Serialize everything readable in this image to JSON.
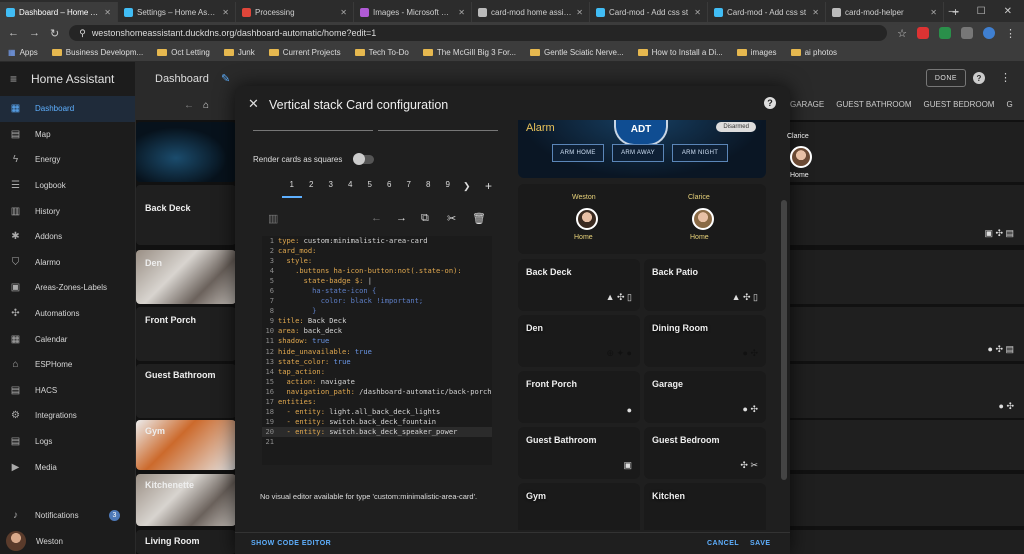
{
  "browser": {
    "tabs": [
      {
        "title": "Dashboard – Home Assistant",
        "color": "#41bdf5",
        "active": true
      },
      {
        "title": "Settings – Home Assistant",
        "color": "#41bdf5",
        "active": false
      },
      {
        "title": "Processing",
        "color": "#e0463a",
        "active": false
      },
      {
        "title": "Images - Microsoft Design",
        "color": "#b15bd6",
        "active": false
      },
      {
        "title": "card-mod home assistant",
        "color": "#bbbbbb",
        "active": false
      },
      {
        "title": "Card-mod - Add css st",
        "color": "#41bdf5",
        "active": false
      },
      {
        "title": "Card-mod - Add css st",
        "color": "#41bdf5",
        "active": false
      },
      {
        "title": "card-mod-helper",
        "color": "#bbbbbb",
        "active": false
      }
    ],
    "address": "westonshomeassistant.duckdns.org/dashboard-automatic/home?edit=1",
    "bookmarks": [
      "Apps",
      "Business Developm...",
      "Oct Letting",
      "Junk",
      "Current Projects",
      "Tech To-Do",
      "The McGill Big 3 For...",
      "Gentle Sciatic Nerve...",
      "How to Install a Di...",
      "images",
      "ai photos"
    ]
  },
  "sidebar": {
    "app_title": "Home Assistant",
    "items": [
      {
        "label": "Dashboard",
        "icon": "dashboard-icon",
        "glyph": "▦"
      },
      {
        "label": "Map",
        "icon": "map-icon",
        "glyph": "▤"
      },
      {
        "label": "Energy",
        "icon": "energy-icon",
        "glyph": "ϟ"
      },
      {
        "label": "Logbook",
        "icon": "logbook-icon",
        "glyph": "☰"
      },
      {
        "label": "History",
        "icon": "history-icon",
        "glyph": "▥"
      },
      {
        "label": "Addons",
        "icon": "addons-icon",
        "glyph": "✱"
      },
      {
        "label": "Alarmo",
        "icon": "shield-icon",
        "glyph": "⛉"
      },
      {
        "label": "Areas-Zones-Labels",
        "icon": "areas-icon",
        "glyph": "▣"
      },
      {
        "label": "Automations",
        "icon": "automations-icon",
        "glyph": "✣"
      },
      {
        "label": "Calendar",
        "icon": "calendar-icon",
        "glyph": "▦"
      },
      {
        "label": "ESPHome",
        "icon": "esphome-icon",
        "glyph": "⌂"
      },
      {
        "label": "HACS",
        "icon": "hacs-icon",
        "glyph": "▤"
      },
      {
        "label": "Integrations",
        "icon": "integrations-icon",
        "glyph": "⚙"
      },
      {
        "label": "Logs",
        "icon": "logs-icon",
        "glyph": "▤"
      },
      {
        "label": "Media",
        "icon": "media-icon",
        "glyph": "▶"
      }
    ],
    "notifications_label": "Notifications",
    "notifications_count": "3",
    "user_name": "Weston"
  },
  "header": {
    "title": "Dashboard",
    "done_label": "DONE",
    "view_tabs": [
      "GARAGE",
      "GUEST BATHROOM",
      "GUEST BEDROOM",
      "G"
    ]
  },
  "background_cards": [
    "Back Deck",
    "Den",
    "Front Porch",
    "Guest Bathroom",
    "Gym",
    "Kitchenette",
    "Living Room"
  ],
  "dialog": {
    "title": "Vertical stack Card configuration",
    "render_squares_label": "Render cards as squares",
    "card_tabs": [
      "1",
      "2",
      "3",
      "4",
      "5",
      "6",
      "7",
      "8",
      "9"
    ],
    "code_lines": [
      [
        [
          "k",
          "type: "
        ],
        [
          "s",
          "custom:minimalistic-area-card"
        ]
      ],
      [
        [
          "k",
          "card_mod:"
        ]
      ],
      [
        [
          "k",
          "  style:"
        ]
      ],
      [
        [
          "k",
          "    .buttons ha-icon-button:not(.state-on):"
        ]
      ],
      [
        [
          "k",
          "      state-badge $: "
        ],
        [
          "s",
          "|"
        ]
      ],
      [
        [
          "d",
          "        ha-state-icon {"
        ]
      ],
      [
        [
          "d",
          "          color: black !important;"
        ]
      ],
      [
        [
          "d",
          "        }"
        ]
      ],
      [
        [
          "k",
          "title: "
        ],
        [
          "s",
          "Back Deck"
        ]
      ],
      [
        [
          "k",
          "area: "
        ],
        [
          "s",
          "back_deck"
        ]
      ],
      [
        [
          "k",
          "shadow: "
        ],
        [
          "b",
          "true"
        ]
      ],
      [
        [
          "k",
          "hide_unavailable: "
        ],
        [
          "b",
          "true"
        ]
      ],
      [
        [
          "k",
          "state_color: "
        ],
        [
          "b",
          "true"
        ]
      ],
      [
        [
          "k",
          "tap_action:"
        ]
      ],
      [
        [
          "k",
          "  action: "
        ],
        [
          "s",
          "navigate"
        ]
      ],
      [
        [
          "k",
          "  navigation_path: "
        ],
        [
          "s",
          "/dashboard-automatic/back-porch"
        ]
      ],
      [
        [
          "k",
          "entities:"
        ]
      ],
      [
        [
          "k",
          "  - entity: "
        ],
        [
          "s",
          "light.all_back_deck_lights"
        ]
      ],
      [
        [
          "k",
          "  - entity: "
        ],
        [
          "s",
          "switch.back_deck_fountain"
        ]
      ],
      [
        [
          "k",
          "  - entity: "
        ],
        [
          "s",
          "switch.back_deck_speaker_power"
        ]
      ],
      [
        [
          "s",
          ""
        ]
      ]
    ],
    "no_visual_editor": "No visual editor available for type 'custom:minimalistic-area-card'.",
    "show_code_label": "SHOW CODE EDITOR",
    "cancel_label": "CANCEL",
    "save_label": "SAVE"
  },
  "preview": {
    "alarm_title": "Alarm",
    "alarm_brand": "ADT",
    "alarm_state": "Disarmed",
    "arm_buttons": [
      "ARM HOME",
      "ARM AWAY",
      "ARM NIGHT"
    ],
    "persons": [
      {
        "name": "Weston",
        "state": "Home"
      },
      {
        "name": "Clarice",
        "state": "Home"
      }
    ],
    "rooms": [
      "Back Deck",
      "Back Patio",
      "Den",
      "Dining Room",
      "Front Porch",
      "Garage",
      "Guest Bathroom",
      "Guest Bedroom",
      "Gym",
      "Kitchen"
    ],
    "right_column_person": {
      "name": "Clarice",
      "state": "Home"
    }
  }
}
